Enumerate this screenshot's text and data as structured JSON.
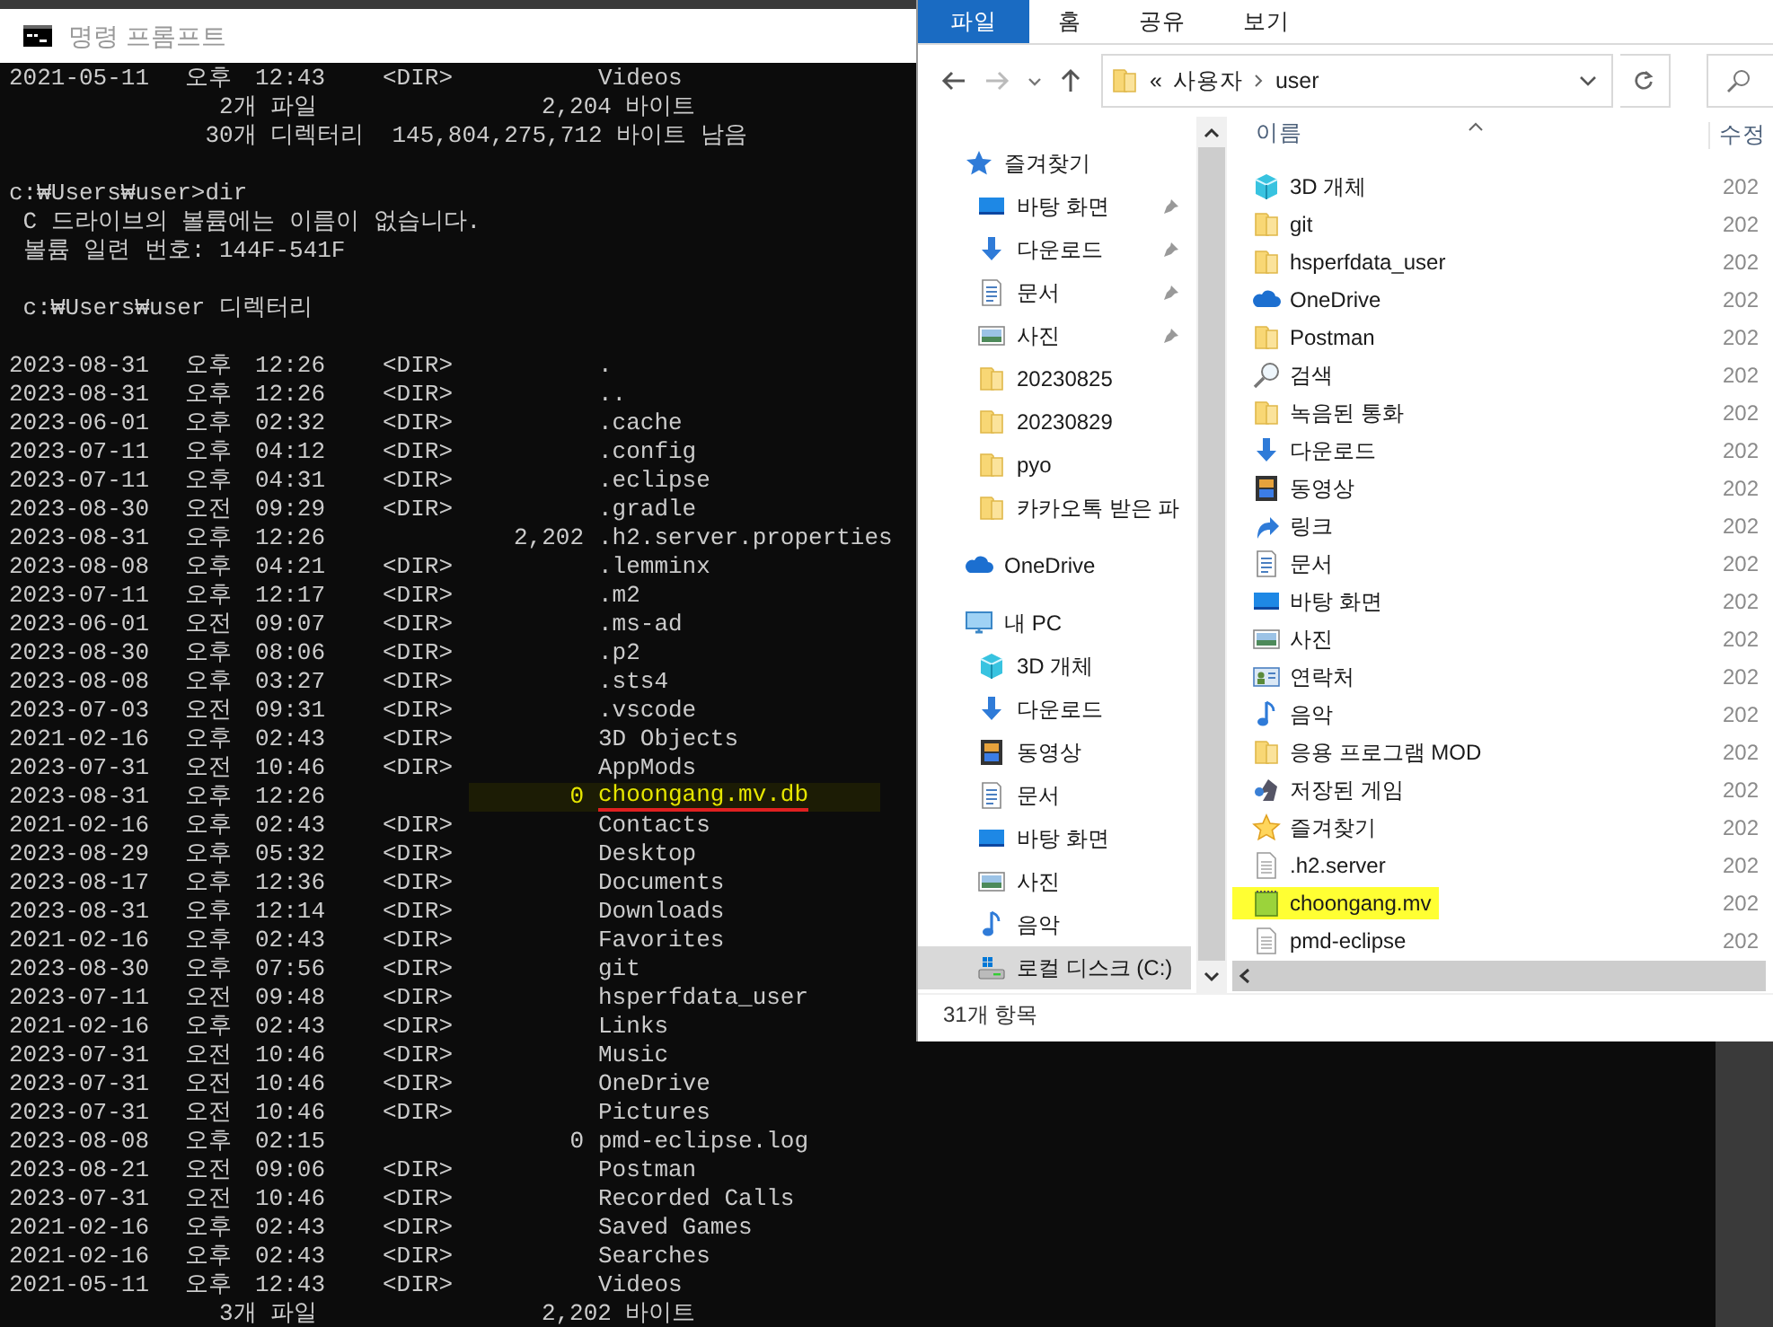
{
  "console": {
    "title": "명령 프롬프트",
    "lines": [
      {
        "kind": "entry",
        "date": "2021-05-11",
        "ampm": "오후",
        "time": "12:43",
        "size": "<DIR>",
        "name": "Videos",
        "highlighted": false
      },
      {
        "kind": "text",
        "text": "               2개 파일                2,204 바이트"
      },
      {
        "kind": "text",
        "text": "              30개 디렉터리  145,804,275,712 바이트 남음"
      },
      {
        "kind": "blank"
      },
      {
        "kind": "text",
        "text": "c:₩Users₩user>dir"
      },
      {
        "kind": "text",
        "text": " C 드라이브의 볼륨에는 이름이 없습니다."
      },
      {
        "kind": "text",
        "text": " 볼륨 일련 번호: 144F-541F"
      },
      {
        "kind": "blank"
      },
      {
        "kind": "text",
        "text": " c:₩Users₩user 디렉터리"
      },
      {
        "kind": "blank"
      },
      {
        "kind": "entry",
        "date": "2023-08-31",
        "ampm": "오후",
        "time": "12:26",
        "size": "<DIR>",
        "name": ".",
        "highlighted": false
      },
      {
        "kind": "entry",
        "date": "2023-08-31",
        "ampm": "오후",
        "time": "12:26",
        "size": "<DIR>",
        "name": "..",
        "highlighted": false
      },
      {
        "kind": "entry",
        "date": "2023-06-01",
        "ampm": "오후",
        "time": "02:32",
        "size": "<DIR>",
        "name": ".cache",
        "highlighted": false
      },
      {
        "kind": "entry",
        "date": "2023-07-11",
        "ampm": "오후",
        "time": "04:12",
        "size": "<DIR>",
        "name": ".config",
        "highlighted": false
      },
      {
        "kind": "entry",
        "date": "2023-07-11",
        "ampm": "오후",
        "time": "04:31",
        "size": "<DIR>",
        "name": ".eclipse",
        "highlighted": false
      },
      {
        "kind": "entry",
        "date": "2023-08-30",
        "ampm": "오전",
        "time": "09:29",
        "size": "<DIR>",
        "name": ".gradle",
        "highlighted": false
      },
      {
        "kind": "entry",
        "date": "2023-08-31",
        "ampm": "오후",
        "time": "12:26",
        "size": "2,202",
        "name": ".h2.server.properties",
        "highlighted": false
      },
      {
        "kind": "entry",
        "date": "2023-08-08",
        "ampm": "오후",
        "time": "04:21",
        "size": "<DIR>",
        "name": ".lemminx",
        "highlighted": false
      },
      {
        "kind": "entry",
        "date": "2023-07-11",
        "ampm": "오후",
        "time": "12:17",
        "size": "<DIR>",
        "name": ".m2",
        "highlighted": false
      },
      {
        "kind": "entry",
        "date": "2023-06-01",
        "ampm": "오전",
        "time": "09:07",
        "size": "<DIR>",
        "name": ".ms-ad",
        "highlighted": false
      },
      {
        "kind": "entry",
        "date": "2023-08-30",
        "ampm": "오후",
        "time": "08:06",
        "size": "<DIR>",
        "name": ".p2",
        "highlighted": false
      },
      {
        "kind": "entry",
        "date": "2023-08-08",
        "ampm": "오후",
        "time": "03:27",
        "size": "<DIR>",
        "name": ".sts4",
        "highlighted": false
      },
      {
        "kind": "entry",
        "date": "2023-07-03",
        "ampm": "오전",
        "time": "09:31",
        "size": "<DIR>",
        "name": ".vscode",
        "highlighted": false
      },
      {
        "kind": "entry",
        "date": "2021-02-16",
        "ampm": "오후",
        "time": "02:43",
        "size": "<DIR>",
        "name": "3D Objects",
        "highlighted": false
      },
      {
        "kind": "entry",
        "date": "2023-07-31",
        "ampm": "오전",
        "time": "10:46",
        "size": "<DIR>",
        "name": "AppMods",
        "highlighted": false
      },
      {
        "kind": "entry",
        "date": "2023-08-31",
        "ampm": "오후",
        "time": "12:26",
        "size": "0",
        "name": "choongang.mv.db",
        "highlighted": true
      },
      {
        "kind": "entry",
        "date": "2021-02-16",
        "ampm": "오후",
        "time": "02:43",
        "size": "<DIR>",
        "name": "Contacts",
        "highlighted": false
      },
      {
        "kind": "entry",
        "date": "2023-08-29",
        "ampm": "오후",
        "time": "05:32",
        "size": "<DIR>",
        "name": "Desktop",
        "highlighted": false
      },
      {
        "kind": "entry",
        "date": "2023-08-17",
        "ampm": "오후",
        "time": "12:36",
        "size": "<DIR>",
        "name": "Documents",
        "highlighted": false
      },
      {
        "kind": "entry",
        "date": "2023-08-31",
        "ampm": "오후",
        "time": "12:14",
        "size": "<DIR>",
        "name": "Downloads",
        "highlighted": false
      },
      {
        "kind": "entry",
        "date": "2021-02-16",
        "ampm": "오후",
        "time": "02:43",
        "size": "<DIR>",
        "name": "Favorites",
        "highlighted": false
      },
      {
        "kind": "entry",
        "date": "2023-08-30",
        "ampm": "오후",
        "time": "07:56",
        "size": "<DIR>",
        "name": "git",
        "highlighted": false
      },
      {
        "kind": "entry",
        "date": "2023-07-11",
        "ampm": "오전",
        "time": "09:48",
        "size": "<DIR>",
        "name": "hsperfdata_user",
        "highlighted": false
      },
      {
        "kind": "entry",
        "date": "2021-02-16",
        "ampm": "오후",
        "time": "02:43",
        "size": "<DIR>",
        "name": "Links",
        "highlighted": false
      },
      {
        "kind": "entry",
        "date": "2023-07-31",
        "ampm": "오전",
        "time": "10:46",
        "size": "<DIR>",
        "name": "Music",
        "highlighted": false
      },
      {
        "kind": "entry",
        "date": "2023-07-31",
        "ampm": "오전",
        "time": "10:46",
        "size": "<DIR>",
        "name": "OneDrive",
        "highlighted": false
      },
      {
        "kind": "entry",
        "date": "2023-07-31",
        "ampm": "오전",
        "time": "10:46",
        "size": "<DIR>",
        "name": "Pictures",
        "highlighted": false
      },
      {
        "kind": "entry",
        "date": "2023-08-08",
        "ampm": "오후",
        "time": "02:15",
        "size": "0",
        "name": "pmd-eclipse.log",
        "highlighted": false
      },
      {
        "kind": "entry",
        "date": "2023-08-21",
        "ampm": "오전",
        "time": "09:06",
        "size": "<DIR>",
        "name": "Postman",
        "highlighted": false
      },
      {
        "kind": "entry",
        "date": "2023-07-31",
        "ampm": "오전",
        "time": "10:46",
        "size": "<DIR>",
        "name": "Recorded Calls",
        "highlighted": false
      },
      {
        "kind": "entry",
        "date": "2021-02-16",
        "ampm": "오후",
        "time": "02:43",
        "size": "<DIR>",
        "name": "Saved Games",
        "highlighted": false
      },
      {
        "kind": "entry",
        "date": "2021-02-16",
        "ampm": "오후",
        "time": "02:43",
        "size": "<DIR>",
        "name": "Searches",
        "highlighted": false
      },
      {
        "kind": "entry",
        "date": "2021-05-11",
        "ampm": "오후",
        "time": "12:43",
        "size": "<DIR>",
        "name": "Videos",
        "highlighted": false
      },
      {
        "kind": "text",
        "text": "               3개 파일                2,202 바이트"
      }
    ]
  },
  "explorer": {
    "ribbon_tabs": [
      {
        "label": "파일",
        "selected": true
      },
      {
        "label": "홈",
        "selected": false
      },
      {
        "label": "공유",
        "selected": false
      },
      {
        "label": "보기",
        "selected": false
      }
    ],
    "address": {
      "overflow": "«",
      "path": [
        "사용자",
        "user"
      ]
    },
    "nav": [
      {
        "label": "즐겨찾기",
        "kind": "star-blue",
        "selected": false,
        "children": [
          {
            "label": "바탕 화면",
            "kind": "desktop",
            "pinned": true,
            "selected": false
          },
          {
            "label": "다운로드",
            "kind": "download",
            "pinned": true,
            "selected": false
          },
          {
            "label": "문서",
            "kind": "document",
            "pinned": true,
            "selected": false
          },
          {
            "label": "사진",
            "kind": "picture",
            "pinned": true,
            "selected": false
          },
          {
            "label": "20230825",
            "kind": "folder",
            "pinned": false,
            "selected": false
          },
          {
            "label": "20230829",
            "kind": "folder",
            "pinned": false,
            "selected": false
          },
          {
            "label": "pyo",
            "kind": "folder",
            "pinned": false,
            "selected": false
          },
          {
            "label": "카카오톡 받은 파",
            "kind": "folder",
            "pinned": false,
            "selected": false
          }
        ]
      },
      {
        "label": "OneDrive",
        "kind": "cloud",
        "selected": false
      },
      {
        "label": "내 PC",
        "kind": "pc",
        "selected": false,
        "children": [
          {
            "label": "3D 개체",
            "kind": "cube",
            "pinned": false,
            "selected": false
          },
          {
            "label": "다운로드",
            "kind": "download",
            "pinned": false,
            "selected": false
          },
          {
            "label": "동영상",
            "kind": "video",
            "pinned": false,
            "selected": false
          },
          {
            "label": "문서",
            "kind": "document",
            "pinned": false,
            "selected": false
          },
          {
            "label": "바탕 화면",
            "kind": "desktop",
            "pinned": false,
            "selected": false
          },
          {
            "label": "사진",
            "kind": "picture",
            "pinned": false,
            "selected": false
          },
          {
            "label": "음악",
            "kind": "music",
            "pinned": false,
            "selected": false
          },
          {
            "label": "로컬 디스크 (C:)",
            "kind": "drive",
            "pinned": false,
            "selected": true
          }
        ]
      }
    ],
    "columns": [
      "이름",
      "수정"
    ],
    "rows": [
      {
        "name": "3D 개체",
        "kind": "cube",
        "date": "202",
        "highlighted": false
      },
      {
        "name": "git",
        "kind": "folder",
        "date": "202",
        "highlighted": false
      },
      {
        "name": "hsperfdata_user",
        "kind": "folder",
        "date": "202",
        "highlighted": false
      },
      {
        "name": "OneDrive",
        "kind": "cloud",
        "date": "202",
        "highlighted": false
      },
      {
        "name": "Postman",
        "kind": "folder",
        "date": "202",
        "highlighted": false
      },
      {
        "name": "검색",
        "kind": "search",
        "date": "202",
        "highlighted": false
      },
      {
        "name": "녹음된 통화",
        "kind": "folder",
        "date": "202",
        "highlighted": false
      },
      {
        "name": "다운로드",
        "kind": "download",
        "date": "202",
        "highlighted": false
      },
      {
        "name": "동영상",
        "kind": "video",
        "date": "202",
        "highlighted": false
      },
      {
        "name": "링크",
        "kind": "link",
        "date": "202",
        "highlighted": false
      },
      {
        "name": "문서",
        "kind": "document",
        "date": "202",
        "highlighted": false
      },
      {
        "name": "바탕 화면",
        "kind": "desktop",
        "date": "202",
        "highlighted": false
      },
      {
        "name": "사진",
        "kind": "picture",
        "date": "202",
        "highlighted": false
      },
      {
        "name": "연락처",
        "kind": "contact",
        "date": "202",
        "highlighted": false
      },
      {
        "name": "음악",
        "kind": "music",
        "date": "202",
        "highlighted": false
      },
      {
        "name": "응용 프로그램 MOD",
        "kind": "folder",
        "date": "202",
        "highlighted": false
      },
      {
        "name": "저장된 게임",
        "kind": "game",
        "date": "202",
        "highlighted": false
      },
      {
        "name": "즐겨찾기",
        "kind": "star",
        "date": "202",
        "highlighted": false
      },
      {
        "name": ".h2.server",
        "kind": "file",
        "date": "202",
        "highlighted": false
      },
      {
        "name": "choongang.mv",
        "kind": "notepad",
        "date": "202",
        "highlighted": true
      },
      {
        "name": "pmd-eclipse",
        "kind": "file",
        "date": "202",
        "highlighted": false
      }
    ],
    "status": "31개 항목"
  }
}
